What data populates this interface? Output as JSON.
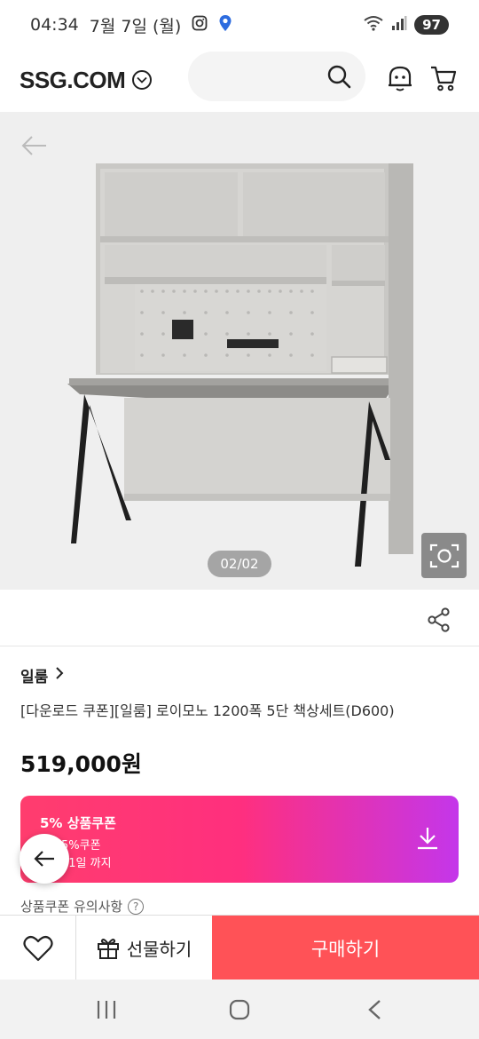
{
  "status_bar": {
    "time": "04:34",
    "date": "7월 7일 (월)",
    "battery": "97"
  },
  "header": {
    "logo": "SSG.COM",
    "icons": [
      "chevron-down-icon",
      "search-icon",
      "alert-icon",
      "cart-icon"
    ]
  },
  "gallery": {
    "counter": "02/02"
  },
  "product": {
    "brand": "일룸",
    "name": "[다운로드 쿠폰][일룸] 로이모노 1200폭 5단 책상세트(D600)",
    "price": "519,000원"
  },
  "coupon": {
    "title": "5% 상품쿠폰",
    "description": "5%쿠폰",
    "period": "31일 까지"
  },
  "coupon_notice": {
    "label": "상품쿠폰 유의사항",
    "help": "?"
  },
  "action_bar": {
    "gift_label": "선물하기",
    "buy_label": "구매하기"
  },
  "colors": {
    "buy": "#ff5257",
    "coupon_start": "#ff3d6e",
    "coupon_end": "#c436ea"
  }
}
